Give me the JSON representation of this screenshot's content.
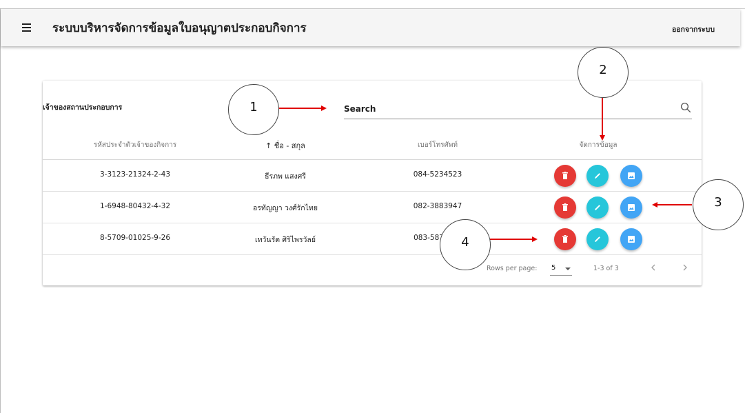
{
  "app": {
    "title": "ระบบบริหารจัดการข้อมูลใบอนุญาตประกอบกิจการ",
    "logout_label": "ออกจากระบบ"
  },
  "card": {
    "title": "เจ้าของสถานประกอบการ",
    "search_placeholder": "Search"
  },
  "table": {
    "headers": [
      "รหัสประจำตัวเจ้าของกิจการ",
      "↑ ชื่อ - สกุล",
      "เบอร์โทรศัพท์",
      "จัดการข้อมูล"
    ],
    "sorted_column": "↑ ชื่อ - สกุล",
    "rows": [
      {
        "id": "3-3123-21324-2-43",
        "name": "ธีรภพ แสงศรี",
        "phone": "084-5234523"
      },
      {
        "id": "1-6948-80432-4-32",
        "name": "อรทัญญา วงศ์รักไทย",
        "phone": "082-3883947"
      },
      {
        "id": "8-5709-01025-9-26",
        "name": "เทวันรัต  ศิริไพรวัลย์",
        "phone": "083-587"
      }
    ],
    "actions": [
      {
        "name": "delete",
        "color": "#e53935",
        "icon": "trash-icon"
      },
      {
        "name": "edit",
        "color": "#26c6da",
        "icon": "pencil-icon"
      },
      {
        "name": "image",
        "color": "#42a5f5",
        "icon": "image-icon"
      }
    ]
  },
  "pagination": {
    "rows_per_page_label": "Rows per page:",
    "rows_per_page_value": "5",
    "range_text": "1-3 of 3"
  },
  "annotations": {
    "callouts": [
      "1",
      "2",
      "3",
      "4"
    ],
    "arrow_color": "#e00000"
  }
}
